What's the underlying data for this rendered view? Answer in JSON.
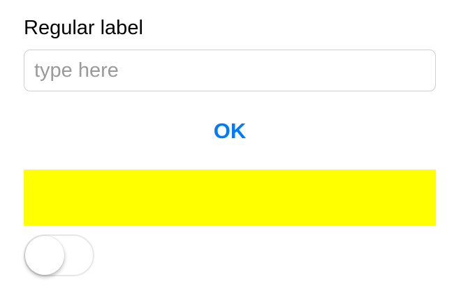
{
  "form": {
    "label": "Regular label",
    "text_field": {
      "value": "",
      "placeholder": "type here"
    },
    "ok_button_label": "OK",
    "switch": {
      "on": false
    }
  },
  "colors": {
    "accent": "#007AFF",
    "yellow_box": "#FFFF00",
    "switch_track_off": "#FFFFFF"
  }
}
